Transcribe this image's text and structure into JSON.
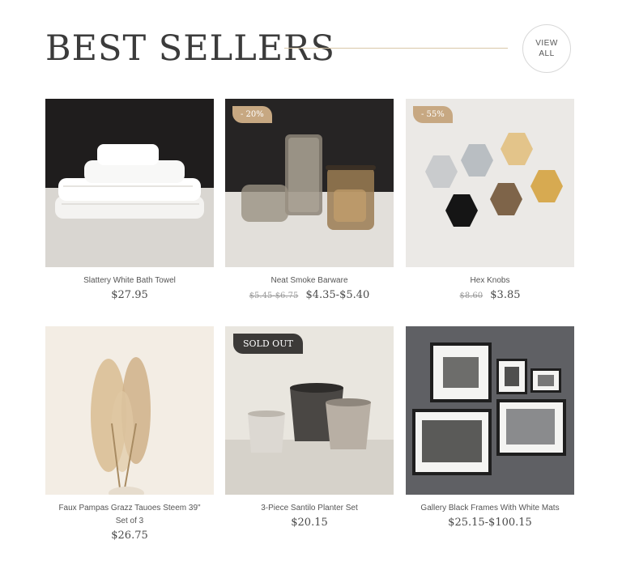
{
  "header": {
    "title": "BEST SELLERS",
    "view_all_line1": "VIEW",
    "view_all_line2": "ALL"
  },
  "products": [
    {
      "name": "Slattery White Bath Towel",
      "price": "$27.95",
      "was_price": "",
      "badge": ""
    },
    {
      "name": "Neat Smoke Barware",
      "price": "$4.35-$5.40",
      "was_price": "$5.45-$6.75",
      "badge": "- 20%"
    },
    {
      "name": "Hex Knobs",
      "price": "$3.85",
      "was_price": "$8.60",
      "badge": "- 55%"
    },
    {
      "name": "Faux Pampas Grazz Tauoes Steem 39\" Set of 3",
      "price": "$26.75",
      "was_price": "",
      "badge": ""
    },
    {
      "name": "3-Piece Santilo Planter Set",
      "price": "$20.15",
      "was_price": "",
      "badge": "SOLD OUT"
    },
    {
      "name": "Gallery Black Frames With White Mats",
      "price": "$25.15-$100.15",
      "was_price": "",
      "badge": ""
    }
  ],
  "colors": {
    "accent_gold": "#c7a882",
    "rule_gold": "#d9c7a8",
    "sold_out_bg": "#3c3a38"
  }
}
